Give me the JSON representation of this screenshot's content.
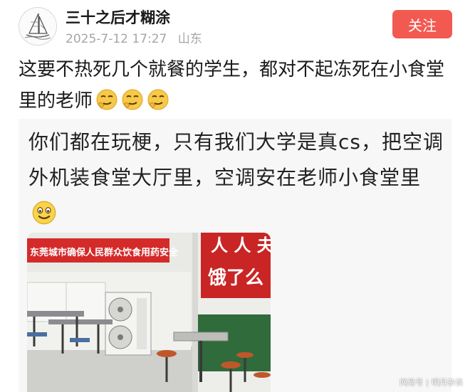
{
  "post": {
    "author": "三十之后才糊涂",
    "date": "2025-7-12 17:27",
    "location": "山东",
    "follow_label": "关注",
    "text": "这要不热死几个就餐的学生，都对不起冻死在小食堂里的老师",
    "text_emojis": [
      "smirk-face-emoji",
      "smirk-face-emoji",
      "smirk-face-emoji"
    ]
  },
  "quoted": {
    "text": "你们都在玩梗，只有我们大学是真cs，把空调外机装食堂大厅里，空调安在老师小食堂里",
    "emoji": "grin-face-emoji"
  },
  "photo": {
    "banner_left": "东莞城市确保人民群众饮食用药安全",
    "banner_right_top": "人 人 夫",
    "banner_right_bottom": "饿了么",
    "icons": [
      "air-conditioner-outdoor-unit",
      "dining-table",
      "stool"
    ]
  },
  "watermark": {
    "source": "网易号",
    "author": "明月杂谈"
  },
  "colors": {
    "follow": "#f25a51",
    "banner": "#d42a2a",
    "meta": "#a6a6a6"
  }
}
